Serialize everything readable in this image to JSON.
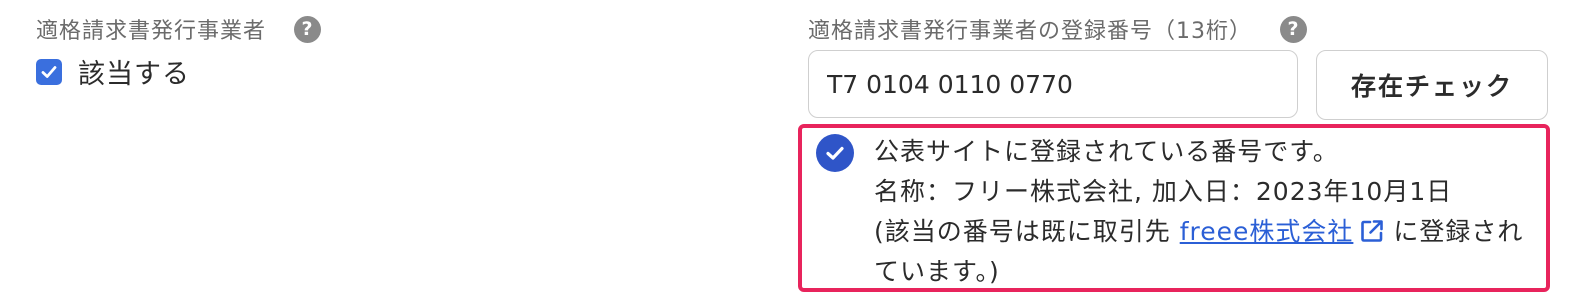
{
  "left": {
    "label": "適格請求書発行事業者",
    "help_icon": "question-circle-icon",
    "checkbox": {
      "checked": true,
      "label": "該当する"
    }
  },
  "right": {
    "label": "適格請求書発行事業者の登録番号（13桁）",
    "help_icon": "question-circle-icon",
    "input_value": "T7 0104 0110 0770",
    "check_button": "存在チェック"
  },
  "result": {
    "icon": "check-circle-icon",
    "line1": "公表サイトに登録されている番号です。",
    "line2": "名称：フリー株式会社,  加入日：2023年10月1日",
    "line3_prefix": "(該当の番号は既に取引先 ",
    "link_text": "freee株式会社",
    "link_icon": "external-link-icon",
    "line3_suffix": "に登録されています。)"
  },
  "colors": {
    "accent": "#3a6fde",
    "highlight_border": "#e8245c",
    "link": "#2b5fd6"
  }
}
